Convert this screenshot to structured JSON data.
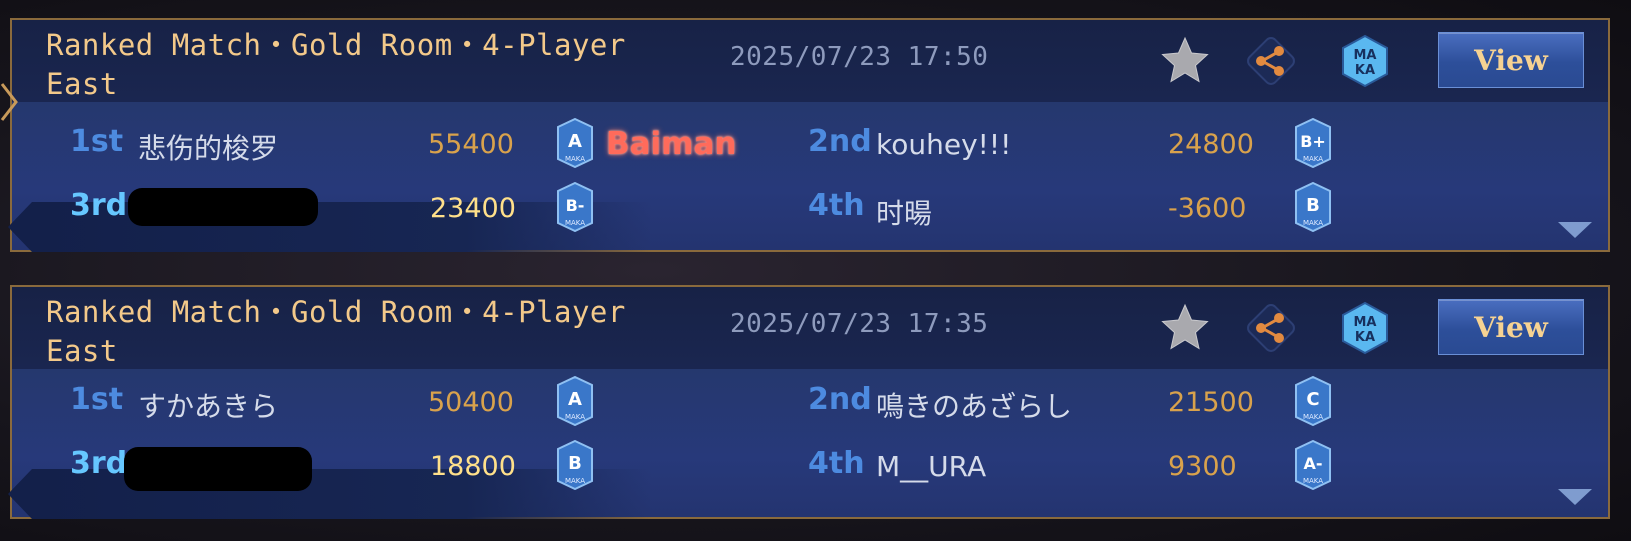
{
  "matches": [
    {
      "title": "Ranked Match・Gold Room・4-Player East",
      "datetime": "2025/07/23 17:50",
      "view_label": "View",
      "maka_icon_text": "MA KA",
      "extra_tag": "Baiman",
      "players": [
        {
          "rank": "1st",
          "name": "悲伤的梭罗",
          "score": "55400",
          "badge": "A",
          "badge_sub": "MAKA"
        },
        {
          "rank": "2nd",
          "name": "kouhey!!!",
          "score": "24800",
          "badge": "B+",
          "badge_sub": "MAKA"
        },
        {
          "rank": "3rd",
          "name": "",
          "score": "23400",
          "badge": "B-",
          "badge_sub": "MAKA"
        },
        {
          "rank": "4th",
          "name": "时暘",
          "score": "-3600",
          "badge": "B",
          "badge_sub": "MAKA"
        }
      ]
    },
    {
      "title": "Ranked Match・Gold Room・4-Player East",
      "datetime": "2025/07/23 17:35",
      "view_label": "View",
      "maka_icon_text": "MA KA",
      "players": [
        {
          "rank": "1st",
          "name": "すかあきら",
          "score": "50400",
          "badge": "A",
          "badge_sub": "MAKA"
        },
        {
          "rank": "2nd",
          "name": "鳴きのあざらし",
          "score": "21500",
          "badge": "C",
          "badge_sub": "MAKA"
        },
        {
          "rank": "3rd",
          "name": "",
          "score": "18800",
          "badge": "B",
          "badge_sub": "MAKA"
        },
        {
          "rank": "4th",
          "name": "M__URA",
          "score": "9300",
          "badge": "A-",
          "badge_sub": "MAKA"
        }
      ]
    }
  ],
  "colors": {
    "title": "#f3c98a",
    "rank": "#4d8be0",
    "score": "#d9a24c",
    "self_score": "#ffe08a",
    "tag": "#ff6b5b"
  }
}
